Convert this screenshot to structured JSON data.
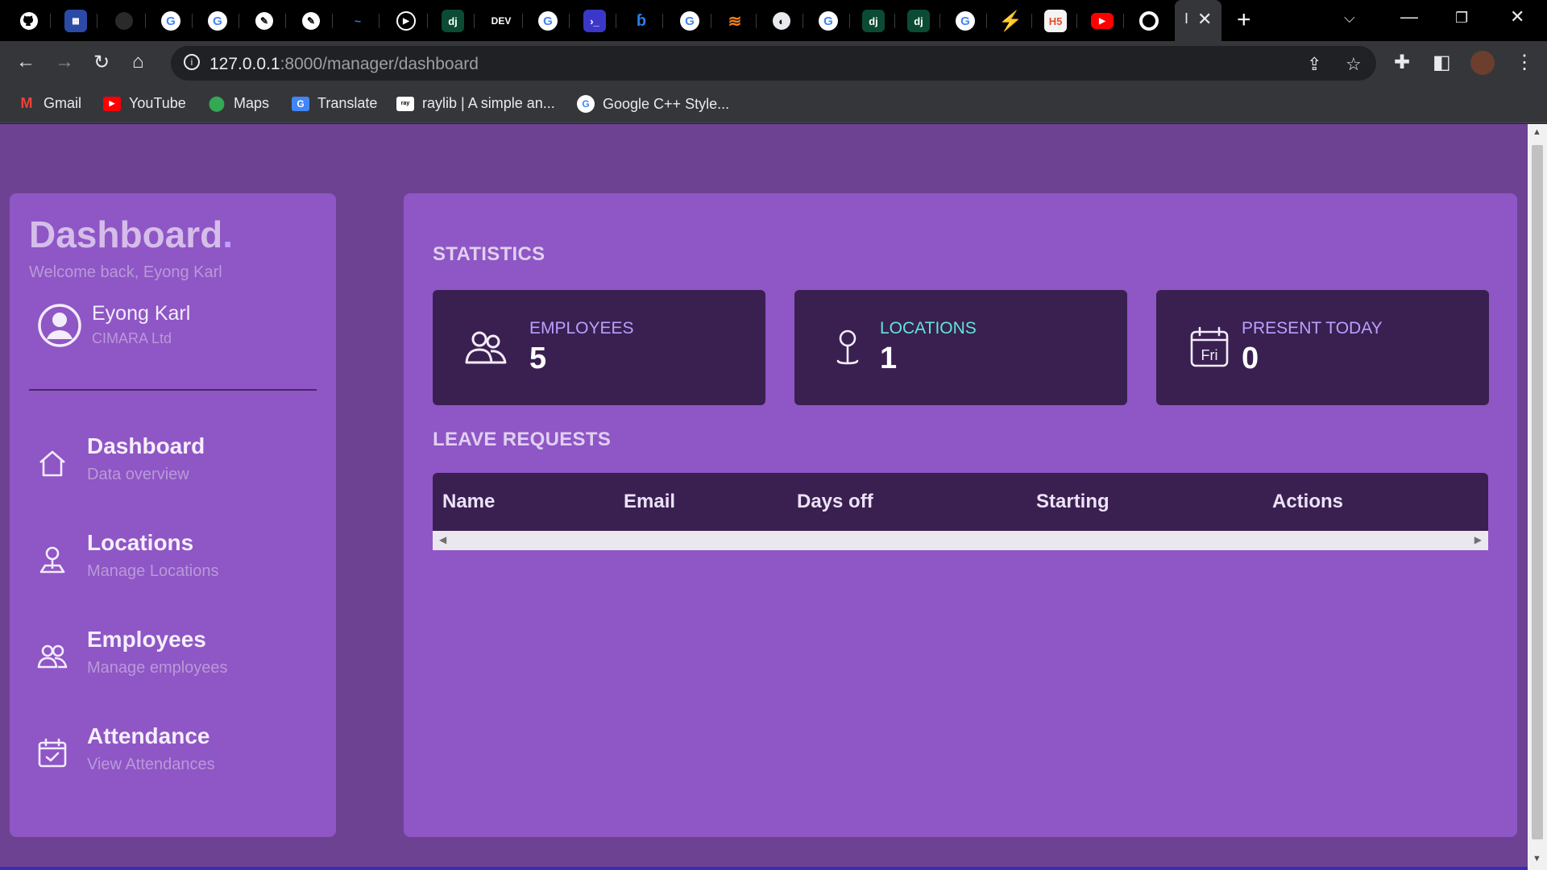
{
  "browser": {
    "tab_favicons": [
      "github-icon",
      "site-icon",
      "site-icon",
      "google-icon",
      "google-icon",
      "site-icon",
      "site-icon",
      "site-icon",
      "play-icon",
      "django-icon",
      "dev-icon",
      "google-icon",
      "terminal-icon",
      "site-icon",
      "google-icon",
      "stackoverflow-icon",
      "globe-icon",
      "google-icon",
      "django-icon",
      "django-icon",
      "google-icon",
      "bolt-icon",
      "html-icon",
      "youtube-icon",
      "chrome-icon"
    ],
    "dj_label": "dj",
    "dev_label": "DEV",
    "active_tab_title": "I",
    "url_host": "127.0.0.1",
    "url_rest": ":8000/manager/dashboard",
    "bookmarks": [
      {
        "label": "Gmail",
        "icon": "gmail-icon",
        "color": "#ea4335"
      },
      {
        "label": "YouTube",
        "icon": "youtube-icon",
        "color": "#ff0000"
      },
      {
        "label": "Maps",
        "icon": "maps-icon",
        "color": "#34a853"
      },
      {
        "label": "Translate",
        "icon": "translate-icon",
        "color": "#4285f4"
      },
      {
        "label": "raylib | A simple an...",
        "icon": "raylib-icon",
        "color": "#ffffff"
      },
      {
        "label": "Google C++ Style...",
        "icon": "google-icon",
        "color": "#4285f4"
      }
    ]
  },
  "sidebar": {
    "brand": "Dashboard",
    "brand_dot": ".",
    "welcome": "Welcome back, Eyong Karl",
    "user_name": "Eyong Karl",
    "user_org": "CIMARA Ltd",
    "items": [
      {
        "title": "Dashboard",
        "sub": "Data overview",
        "icon": "home-icon"
      },
      {
        "title": "Locations",
        "sub": "Manage Locations",
        "icon": "location-pin-icon"
      },
      {
        "title": "Employees",
        "sub": "Manage employees",
        "icon": "people-icon"
      },
      {
        "title": "Attendance",
        "sub": "View Attendances",
        "icon": "calendar-check-icon"
      }
    ]
  },
  "main": {
    "statistics_title": "STATISTICS",
    "cards": [
      {
        "label": "EMPLOYEES",
        "value": "5",
        "icon": "people-icon",
        "label_color": "#b9a0ff"
      },
      {
        "label": "LOCATIONS",
        "value": "1",
        "icon": "location-pin-icon",
        "label_color": "#62e6d6"
      },
      {
        "label": "PRESENT TODAY",
        "value": "0",
        "icon": "calendar-day-icon",
        "label_color": "#b9a0ff",
        "icon_text": "Fri"
      }
    ],
    "leave_title": "LEAVE REQUESTS",
    "table_headers": [
      "Name",
      "Email",
      "Days off",
      "Starting",
      "Actions"
    ]
  },
  "colors": {
    "page_bg": "#6d4293",
    "panel_bg": "#8f56c6",
    "card_bg": "#3a2050"
  }
}
